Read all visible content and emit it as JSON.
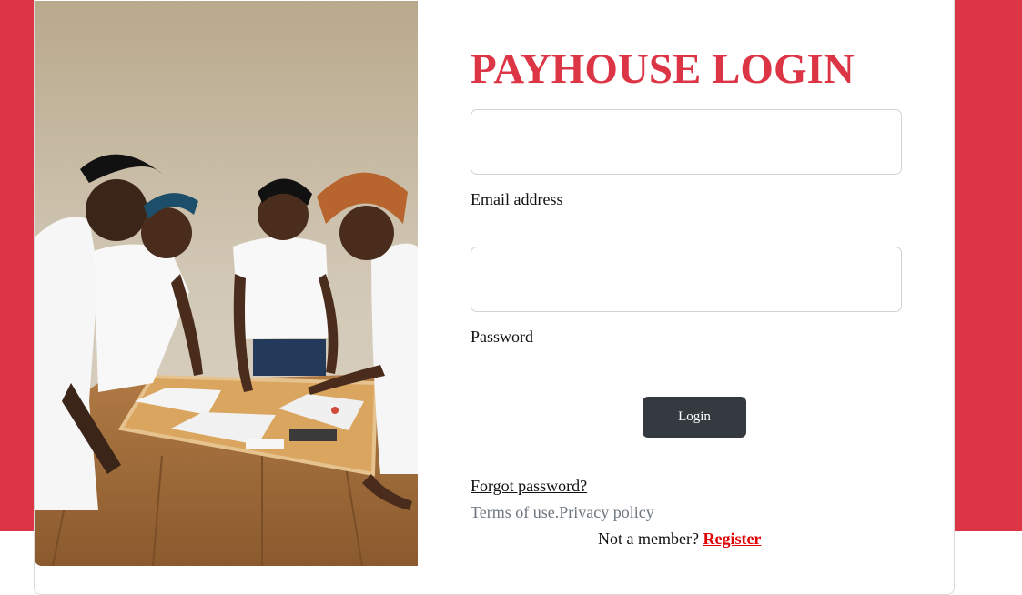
{
  "login": {
    "title": "PAYHOUSE LOGIN",
    "email_label": "Email address",
    "email_value": "",
    "password_label": "Password",
    "password_value": "",
    "submit_label": "Login",
    "forgot_label": "Forgot password?",
    "terms_label": "Terms of use.",
    "privacy_label": "Privacy policy",
    "not_member_text": "Not a member?",
    "register_label": "Register"
  },
  "hero_image": {
    "description_icon": "team-collaboration-photo"
  },
  "colors": {
    "brand_red": "#dc3545",
    "button_dark": "#343a40",
    "register_red": "#e00000",
    "muted_text": "#6c757d"
  }
}
